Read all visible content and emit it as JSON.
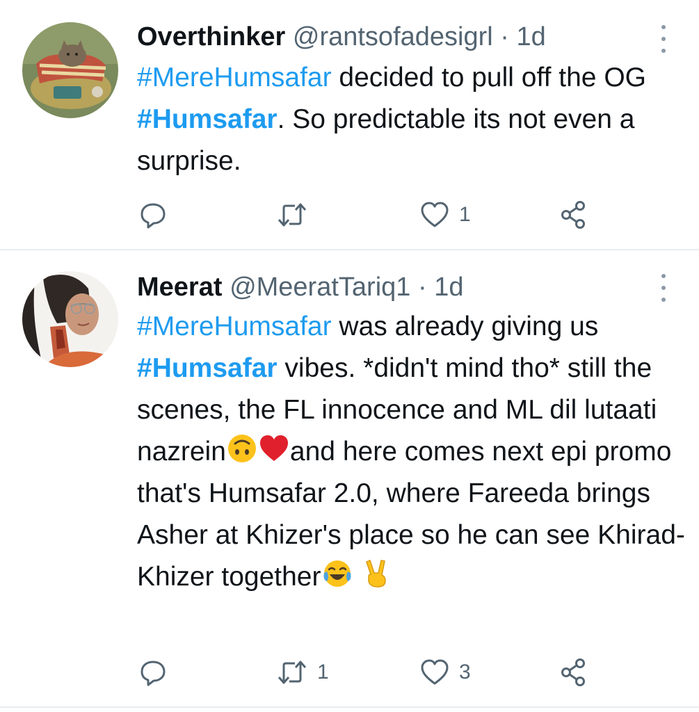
{
  "tweets": [
    {
      "display_name": "Overthinker",
      "handle": "@rantsofadesigrl",
      "separator": "·",
      "time": "1d",
      "text": [
        {
          "t": "#MereHumsafar",
          "kind": "hashtag"
        },
        {
          "t": " decided to pull off the OG ",
          "kind": "text"
        },
        {
          "t": "#Humsafar",
          "kind": "hashtag-bold"
        },
        {
          "t": ". So predictable its not even a surprise.",
          "kind": "text"
        }
      ],
      "counts": {
        "reply": "",
        "retweet": "",
        "like": "1"
      }
    },
    {
      "display_name": "Meerat",
      "handle": "@MeeratTariq1",
      "separator": "·",
      "time": "1d",
      "text": [
        {
          "t": "#MereHumsafar",
          "kind": "hashtag"
        },
        {
          "t": " was already giving us ",
          "kind": "text"
        },
        {
          "t": "#Humsafar",
          "kind": "hashtag-bold"
        },
        {
          "t": " vibes.  *didn't mind tho* still the scenes, the FL innocence and ML dil lutaati nazrein",
          "kind": "text"
        },
        {
          "t": "upside-down-face-emoji",
          "kind": "emoji"
        },
        {
          "t": "red-heart-emoji",
          "kind": "emoji"
        },
        {
          "t": "and here comes next epi promo that's Humsafar 2.0, where Fareeda brings Asher at Khizer's place so he can see Khirad-Khizer together",
          "kind": "text"
        },
        {
          "t": "tears-of-joy-emoji",
          "kind": "emoji"
        },
        {
          "t": " ",
          "kind": "text"
        },
        {
          "t": "victory-hand-emoji",
          "kind": "emoji"
        }
      ],
      "counts": {
        "reply": "",
        "retweet": "1",
        "like": "3"
      }
    }
  ],
  "icons": {
    "reply": "reply-icon",
    "retweet": "retweet-icon",
    "like": "heart-icon",
    "share": "share-icon",
    "more": "more-vertical-icon"
  },
  "colors": {
    "hashtag": "#1d9bf0",
    "secondary_text": "#536471",
    "icon": "#536471",
    "divider": "#e8ecef"
  }
}
